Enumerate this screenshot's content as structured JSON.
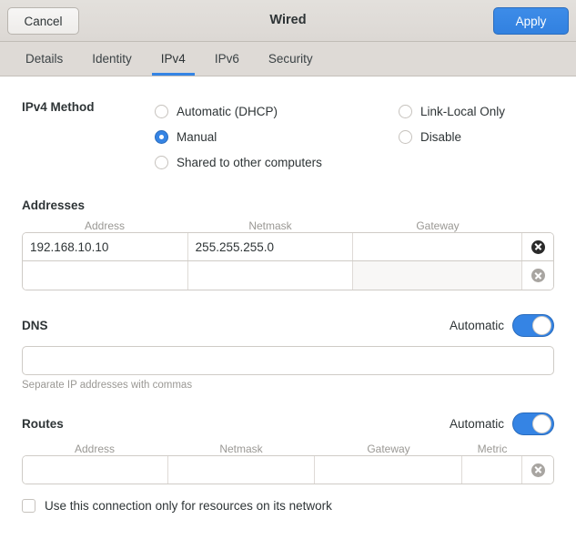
{
  "window": {
    "title": "Wired",
    "cancel_label": "Cancel",
    "apply_label": "Apply"
  },
  "tabs": [
    {
      "label": "Details",
      "active": false
    },
    {
      "label": "Identity",
      "active": false
    },
    {
      "label": "IPv4",
      "active": true
    },
    {
      "label": "IPv6",
      "active": false
    },
    {
      "label": "Security",
      "active": false
    }
  ],
  "method": {
    "label": "IPv4 Method",
    "left_options": [
      {
        "label": "Automatic (DHCP)",
        "selected": false
      },
      {
        "label": "Manual",
        "selected": true
      },
      {
        "label": "Shared to other computers",
        "selected": false
      }
    ],
    "right_options": [
      {
        "label": "Link-Local Only",
        "selected": false
      },
      {
        "label": "Disable",
        "selected": false
      }
    ]
  },
  "addresses": {
    "title": "Addresses",
    "columns": [
      "Address",
      "Netmask",
      "Gateway"
    ],
    "rows": [
      {
        "address": "192.168.10.10",
        "netmask": "255.255.255.0",
        "gateway": ""
      },
      {
        "address": "",
        "netmask": "",
        "gateway": ""
      }
    ]
  },
  "dns": {
    "title": "DNS",
    "automatic_label": "Automatic",
    "automatic_on": true,
    "value": "",
    "hint": "Separate IP addresses with commas"
  },
  "routes": {
    "title": "Routes",
    "automatic_label": "Automatic",
    "automatic_on": true,
    "columns": [
      "Address",
      "Netmask",
      "Gateway",
      "Metric"
    ],
    "rows": [
      {
        "address": "",
        "netmask": "",
        "gateway": "",
        "metric": ""
      }
    ]
  },
  "restrict": {
    "label": "Use this connection only for resources on its network",
    "checked": false
  },
  "colors": {
    "accent": "#3584e4",
    "headerbar": "#dedad6",
    "body": "#ffffff",
    "muted_text": "#9a9894"
  }
}
